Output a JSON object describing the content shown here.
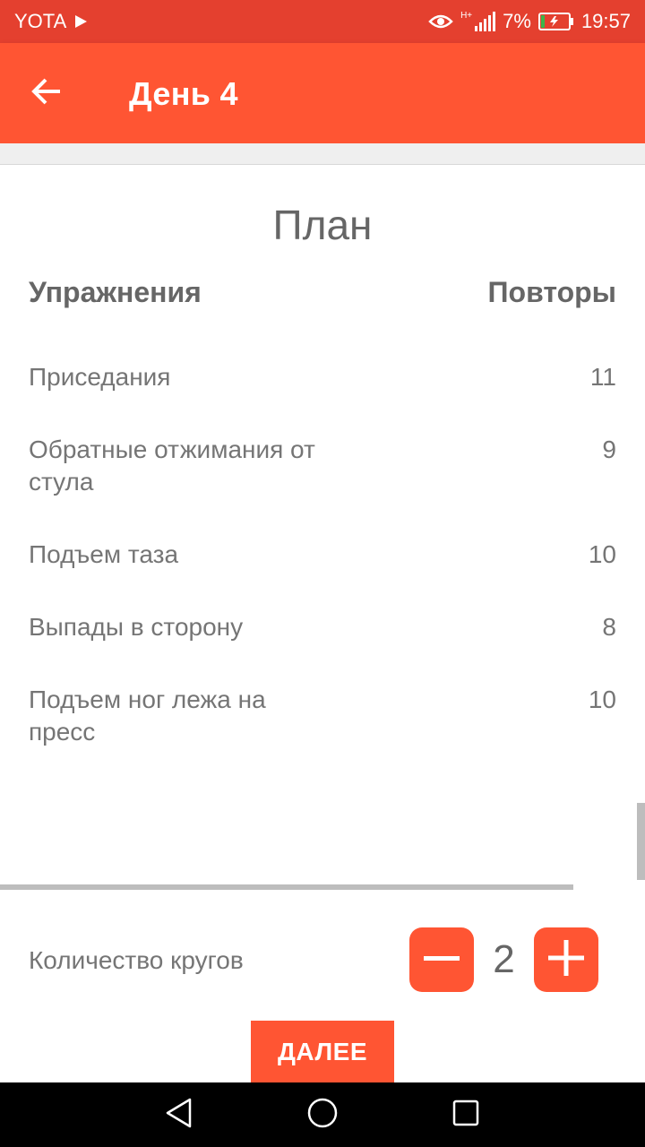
{
  "status_bar": {
    "carrier": "YOTA",
    "network": "H+",
    "battery": "7%",
    "time": "19:57",
    "icons": [
      "play-icon",
      "eye-icon",
      "signal-icon",
      "battery-icon"
    ]
  },
  "toolbar": {
    "title": "День 4",
    "back_icon": "arrow-back-icon"
  },
  "plan": {
    "title": "План",
    "col_exercises": "Упражнения",
    "col_reps": "Повторы",
    "exercises": [
      {
        "name": "Приседания",
        "reps": "11"
      },
      {
        "name": "Обратные отжимания от стула",
        "reps": "9"
      },
      {
        "name": "Подъем таза",
        "reps": "10"
      },
      {
        "name": "Выпады в сторону",
        "reps": "8"
      },
      {
        "name": "Подъем ног лежа на пресс",
        "reps": "10"
      }
    ]
  },
  "rounds": {
    "label": "Количество кругов",
    "value": "2",
    "minus_icon": "minus-icon",
    "plus_icon": "plus-icon"
  },
  "next_button": "ДАЛЕЕ",
  "nav": {
    "icons": [
      "nav-back-icon",
      "nav-home-icon",
      "nav-recents-icon"
    ]
  },
  "colors": {
    "status_bar": "#e4402f",
    "accent": "#ff5533",
    "text": "#757575"
  }
}
